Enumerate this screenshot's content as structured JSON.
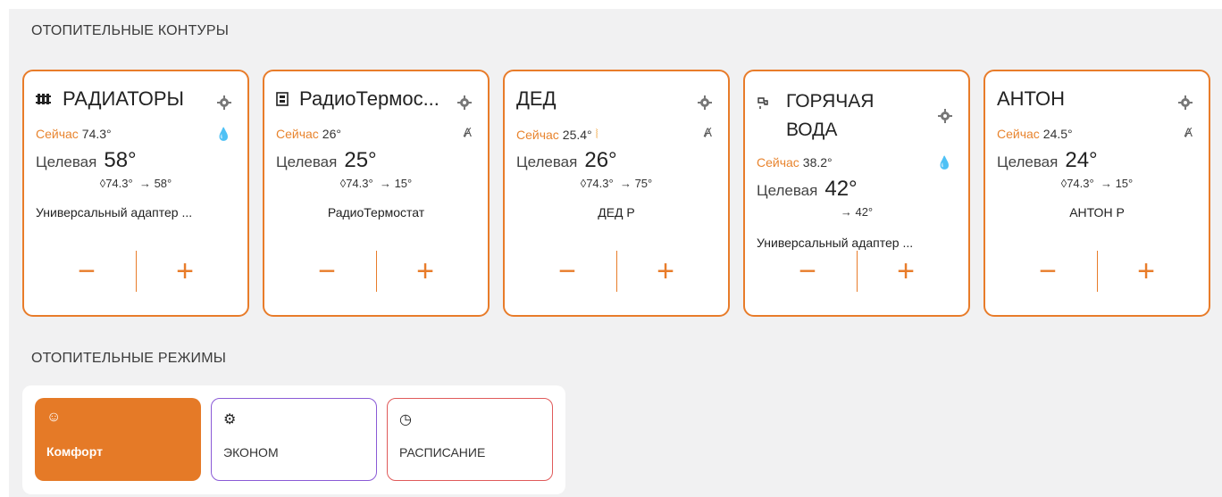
{
  "sections": {
    "circuits_title": "ОТОПИТЕЛЬНЫЕ КОНТУРЫ",
    "modes_title": "ОТОПИТЕЛЬНЫЕ РЕЖИМЫ"
  },
  "cards": [
    {
      "title": "РАДИАТОРЫ",
      "icon": "radiator-icon",
      "now_label": "Сейчас",
      "now_value": "74.3°",
      "target_label": "Целевая",
      "target_value": "58°",
      "sensor_value": "74.3°",
      "setpoint": "→ 58°",
      "description": "Универсальный адаптер ..."
    },
    {
      "title": "РадиоТермос...",
      "icon": "thermostat-icon",
      "now_label": "Сейчас",
      "now_value": "26°",
      "target_label": "Целевая",
      "target_value": "25°",
      "sensor_value": "74.3°",
      "setpoint": "→ 15°",
      "description": "РадиоТермостат"
    },
    {
      "title": "ДЕД",
      "now_label": "Сейчас",
      "now_value": "25.4°",
      "target_label": "Целевая",
      "target_value": "26°",
      "sensor_value": "74.3°",
      "setpoint": "→ 75°",
      "description": "ДЕД Р"
    },
    {
      "title_line1": "ГОРЯЧАЯ",
      "title_line2": "ВОДА",
      "icon": "tap-icon",
      "now_label": "Сейчас",
      "now_value": "38.2°",
      "target_label": "Целевая",
      "target_value": "42°",
      "setpoint": "→ 42°",
      "description": "Универсальный адаптер ..."
    },
    {
      "title": "АНТОН",
      "now_label": "Сейчас",
      "now_value": "24.5°",
      "target_label": "Целевая",
      "target_value": "24°",
      "sensor_value": "74.3°",
      "setpoint": "→ 15°",
      "description": "АНТОН Р"
    }
  ],
  "controls": {
    "minus": "−",
    "plus": "+"
  },
  "modes": [
    {
      "label": "Комфорт",
      "icon": "smile-icon",
      "active": true,
      "color": "#e57a27"
    },
    {
      "label": "ЭКОНОМ",
      "icon": "eco-icon",
      "active": false,
      "color": "#8a5ad6"
    },
    {
      "label": "РАСПИСАНИЕ",
      "icon": "clock-icon",
      "active": false,
      "color": "#e05a5a"
    }
  ],
  "colors": {
    "accent": "#e87c2a",
    "now_label": "#e8842e"
  }
}
